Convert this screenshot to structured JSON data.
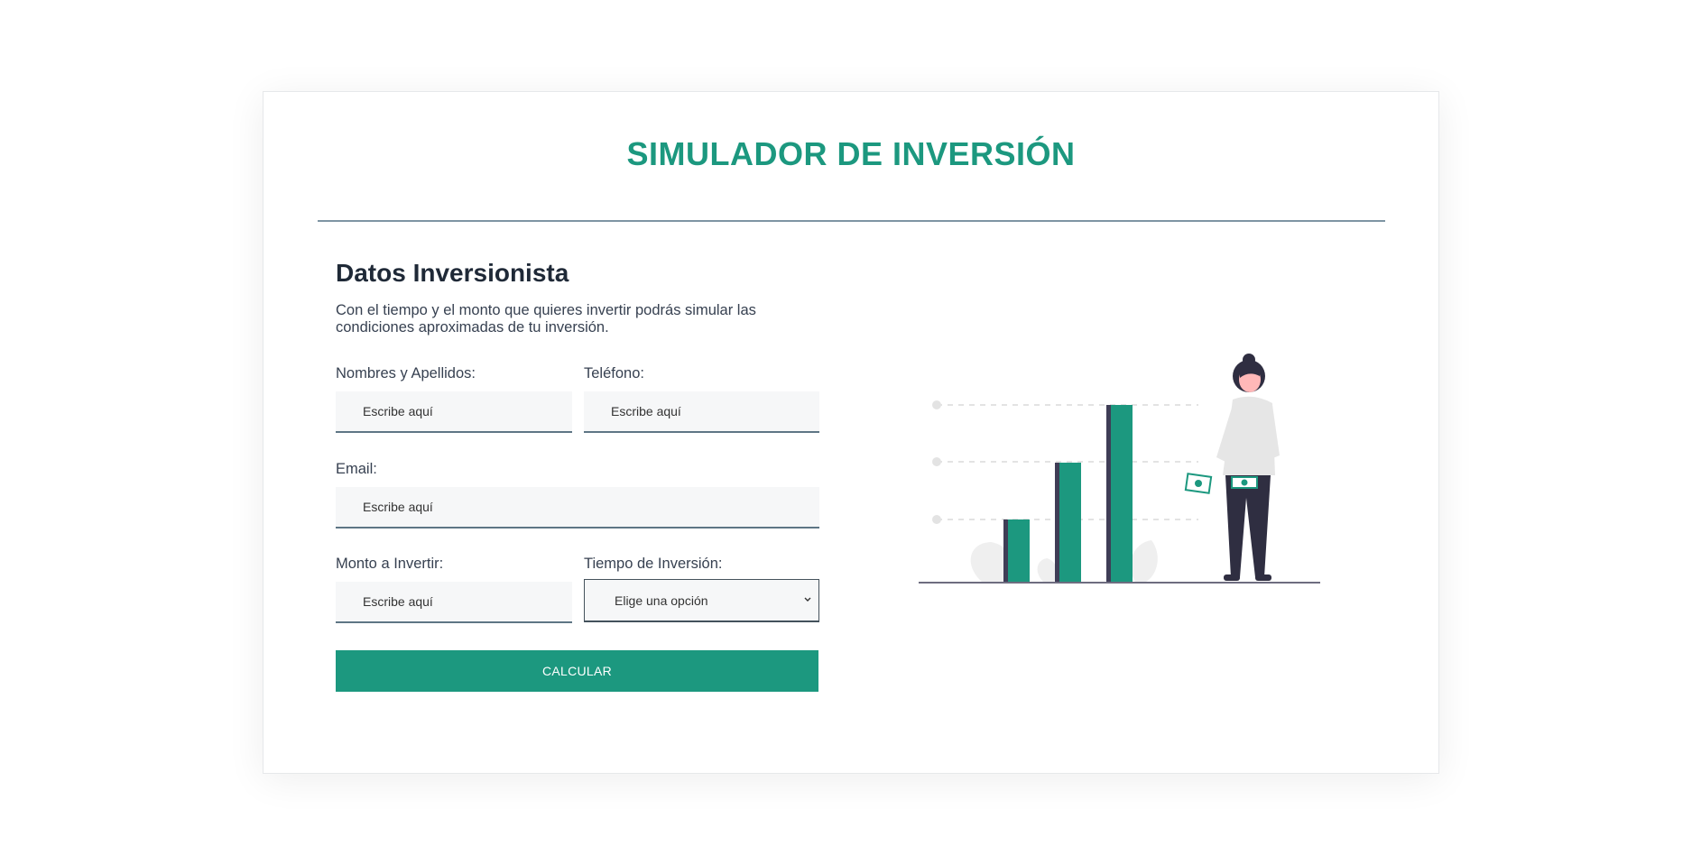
{
  "header": {
    "title": "SIMULADOR DE INVERSIÓN"
  },
  "form": {
    "section_title": "Datos Inversionista",
    "description": "Con el tiempo y el monto que quieres invertir podrás simular las condiciones aproximadas de tu inversión.",
    "name_label": "Nombres y Apellidos:",
    "name_placeholder": "Escribe aquí",
    "phone_label": "Teléfono:",
    "phone_placeholder": "Escribe aquí",
    "email_label": "Email:",
    "email_placeholder": "Escribe aquí",
    "amount_label": "Monto a Invertir:",
    "amount_placeholder": "Escribe aquí",
    "time_label": "Tiempo de Inversión:",
    "time_selected": "Elige una opción",
    "submit_label": "CALCULAR"
  },
  "colors": {
    "accent": "#1c987f",
    "divider": "#7e95a3",
    "text_dark": "#1f2937"
  },
  "icons": {
    "select": "chevron-down-icon"
  }
}
